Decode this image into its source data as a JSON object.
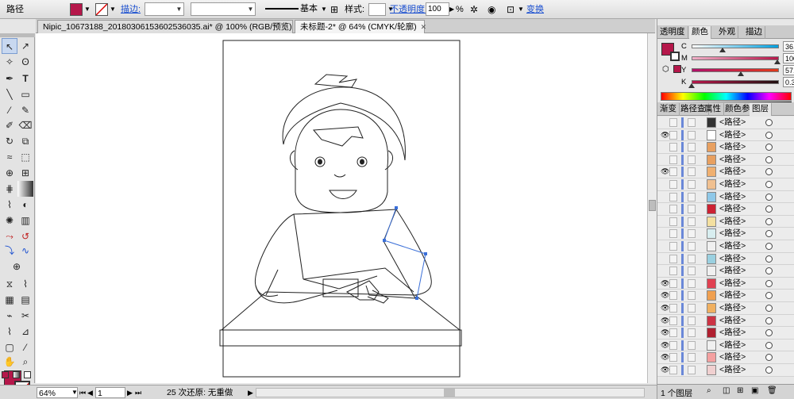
{
  "control_bar": {
    "object_type": "路径",
    "stroke_label": "描边:",
    "stroke_profile_label": "基本",
    "style_label": "样式:",
    "opacity_label": "不透明度:",
    "opacity_value": "100",
    "opacity_unit": "%",
    "transform_label": "变换",
    "fill_color": "#b5174a"
  },
  "tabs": [
    {
      "label": "Nipic_10673188_20180306153602536035.ai* @ 100% (RGB/预览)"
    },
    {
      "label": "未标题-2* @ 64% (CMYK/轮廓)"
    }
  ],
  "status_bar": {
    "zoom": "64%",
    "page": "1",
    "undo_text": "25 次还原: 无重做"
  },
  "color_panel": {
    "tabs": [
      "透明度",
      "颜色",
      "外观",
      "描边"
    ],
    "sliders": [
      {
        "label": "C",
        "value": "36.33",
        "level": 0.3633
      },
      {
        "label": "M",
        "value": "100",
        "level": 1.0
      },
      {
        "label": "Y",
        "value": "57.81",
        "level": 0.5781
      },
      {
        "label": "K",
        "value": "0.39",
        "level": 0.0039
      }
    ],
    "current_color": "#b5174a"
  },
  "layers_panel": {
    "tabs": [
      "渐变",
      "路径查",
      "属性",
      "颜色参",
      "图层"
    ],
    "rows": [
      {
        "name": "<路径>",
        "thumb": "#333333",
        "eye": false
      },
      {
        "name": "<路径>",
        "thumb": "#ffffff",
        "eye": true
      },
      {
        "name": "<路径>",
        "thumb": "#e8a060",
        "eye": false
      },
      {
        "name": "<路径>",
        "thumb": "#e8a060",
        "eye": false
      },
      {
        "name": "<路径>",
        "thumb": "#f0b070",
        "eye": true
      },
      {
        "name": "<路径>",
        "thumb": "#f0c090",
        "eye": false
      },
      {
        "name": "<路径>",
        "thumb": "#8fc8e8",
        "eye": false
      },
      {
        "name": "<路径>",
        "thumb": "#cc2233",
        "eye": false
      },
      {
        "name": "<路径>",
        "thumb": "#f4e0a0",
        "eye": false
      },
      {
        "name": "<路径>",
        "thumb": "#d8eef0",
        "eye": false
      },
      {
        "name": "<路径>",
        "thumb": "#f0f0f0",
        "eye": false
      },
      {
        "name": "<路径>",
        "thumb": "#9ad0e0",
        "eye": false
      },
      {
        "name": "<路径>",
        "thumb": "#f0f0f0",
        "eye": false
      },
      {
        "name": "<路径>",
        "thumb": "#e04050",
        "eye": true
      },
      {
        "name": "<路径>",
        "thumb": "#f0a050",
        "eye": true
      },
      {
        "name": "<路径>",
        "thumb": "#f0b060",
        "eye": true
      },
      {
        "name": "<路径>",
        "thumb": "#cc3344",
        "eye": true
      },
      {
        "name": "<路径>",
        "thumb": "#b02030",
        "eye": true
      },
      {
        "name": "<路径>",
        "thumb": "#f0f0f0",
        "eye": true
      },
      {
        "name": "<路径>",
        "thumb": "#f4a0a0",
        "eye": true
      },
      {
        "name": "<路径>",
        "thumb": "#f0d0d0",
        "eye": true
      }
    ],
    "layer_count_label": "1 个图层"
  }
}
